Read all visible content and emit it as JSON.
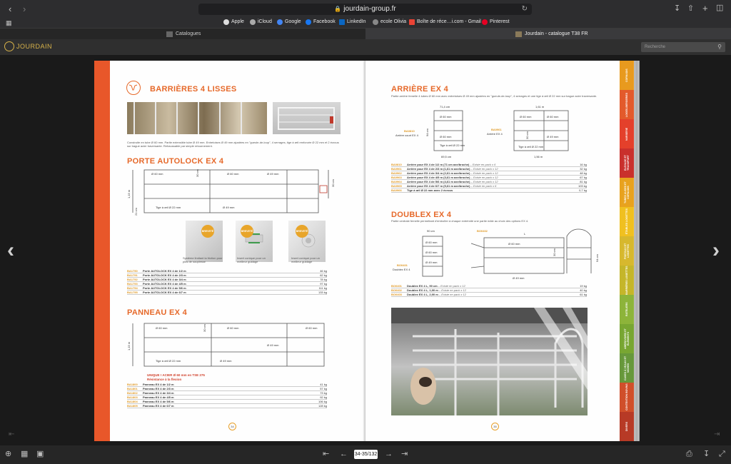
{
  "browser": {
    "url": "jourdain-group.fr",
    "bookmarks": [
      "Apple",
      "iCloud",
      "Google",
      "Facebook",
      "LinkedIn",
      "ecole Olivia",
      "Boîte de réce…i.com - Gmail",
      "Pinterest"
    ],
    "tabs": [
      "Catalogues",
      "Jourdain - catalogue T38 FR"
    ]
  },
  "app": {
    "brand": "JOURDAIN",
    "search_placeholder": "Recherche"
  },
  "left_page": {
    "title": "BARRIÈRES 4 LISSES",
    "intro": "Construite en tube Ø 60 mm. Partie extensible tube Ø 49 mm. Entretoises Ø 49 mm ajustées en \"gueule-de-loup\", 4 serrages, tige à œil renforcée Ø 22 mm et 2 écrous sur bague acier traversante. Rehaussable par simple retournement.",
    "porte": {
      "title": "PORTE AUTOLOCK EX 4",
      "dims": [
        "Ø 60 mm",
        "30 cm",
        "Ø 60 mm",
        "Ø 49 mm",
        "30 cm",
        "1,15 m",
        "21 cm",
        "Tige à œil Ø 22 mm",
        "Ø 49 mm"
      ],
      "badges": [
        "BREVETÉ",
        "BREVETÉ",
        "BREVETÉ"
      ],
      "captions": [
        "Système limitant la friction pour plus de souplesse",
        "Insert conique pour un meilleur guidage",
        "Insert conique pour un meilleur guidage"
      ],
      "rows": [
        {
          "code": "BA1750",
          "desc": "Porte AUTOLOCK EX 4 de 1/2 m",
          "w": "46 kg"
        },
        {
          "code": "BA1751",
          "desc": "Porte AUTOLOCK EX 4 de 2/3 m",
          "w": "62 kg"
        },
        {
          "code": "BA1752",
          "desc": "Porte AUTOLOCK EX 4 de 3/4 m",
          "w": "78 kg"
        },
        {
          "code": "BA1753",
          "desc": "Porte AUTOLOCK EX 4 de 4/5 m",
          "w": "97 kg"
        },
        {
          "code": "BA1754",
          "desc": "Porte AUTOLOCK EX 4 de 5/6 m",
          "w": "111 kg"
        },
        {
          "code": "BA1755",
          "desc": "Porte AUTOLOCK EX 4 de 6/7 m",
          "w": "133 kg"
        }
      ]
    },
    "panneau": {
      "title": "PANNEAU EX 4",
      "dims": [
        "Ø 60 mm",
        "30 cm",
        "Ø 60 mm",
        "Ø 60 mm",
        "1,15 m",
        "Ø 49 mm",
        "Tige à œil Ø 22 mm",
        "Ø 49 mm"
      ],
      "note1": "UNIQUE ! ACIER Ø 60 mm en TSE 275",
      "note2": "Résistance à la flexion",
      "rows": [
        {
          "code": "BA1800",
          "desc": "Panneau EX 4 de 1/2 m",
          "w": "41 kg"
        },
        {
          "code": "BA1801",
          "desc": "Panneau EX 4 de 2/3 m",
          "w": "57 kg"
        },
        {
          "code": "BA1802",
          "desc": "Panneau EX 4 de 3/4 m",
          "w": "73 kg"
        },
        {
          "code": "BA1803",
          "desc": "Panneau EX 4 de 4/5 m",
          "w": "92 kg"
        },
        {
          "code": "BA1804",
          "desc": "Panneau EX 4 de 5/6 m",
          "w": "106 kg"
        },
        {
          "code": "BA1805",
          "desc": "Panneau EX 4 de 6/7 m",
          "w": "128 kg"
        }
      ]
    },
    "page_number": "34"
  },
  "right_page": {
    "arriere": {
      "title": "ARRIÈRE EX 4",
      "intro": "Partie arrière femelle 4 tubes Ø 60 mm avec entretoises Ø 49 mm ajustées en \"gueule-de-loup\", 4 serrages et une tige à œil Ø 22 mm sur bague acier traversante.",
      "dim_labels": [
        "71,4 cm",
        "Ø 60 mm",
        "94 cm",
        "Ø 60 mm",
        "BA0810",
        "Arrière court EX 4",
        "Tige à œil Ø 22 mm",
        "69,5 cm",
        "1,61 m",
        "Ø 60 mm",
        "Ø 60 mm",
        "BA0961",
        "Arrière EX 4",
        "30 cm",
        "Ø 49 mm",
        "Tige à œil Ø 22 mm",
        "1,56 m"
      ],
      "rows": [
        {
          "code": "BA0810",
          "desc": "Arrière pour EX 4 de 1/2 m (71 cm axe/broche)",
          "note": "Existe en pack x 6",
          "w": "16 kg"
        },
        {
          "code": "BA0961",
          "desc": "Arrière pour EX 4 de 2/3 m (1,61 m axe/broche)",
          "note": "Existe en pack x 12",
          "w": "32 kg"
        },
        {
          "code": "BA0962",
          "desc": "Arrière pour EX 4 de 3/4 m (2,61 m axe/broche)",
          "note": "Existe en pack x 12",
          "w": "48 kg"
        },
        {
          "code": "BA0963",
          "desc": "Arrière pour EX 4 de 4/5 m (3,61 m axe/broche)",
          "note": "Existe en pack x 12",
          "w": "67 kg"
        },
        {
          "code": "BA0964",
          "desc": "Arrière pour EX 4 de 5/6 m (4,61 m axe/broche)",
          "note": "Existe en pack x 12",
          "w": "81 kg"
        },
        {
          "code": "BA0965",
          "desc": "Arrière pour EX 4 de 6/7 m (5,61 m axe/broche)",
          "note": "Existe en pack x 6",
          "w": "103 kg"
        },
        {
          "code": "BA0966",
          "desc": "Tige à œil Ø 22 mm avec 2 écrous",
          "note": "",
          "w": "0,7 kg"
        }
      ]
    },
    "doublex": {
      "title": "DOUBLEX EX 4",
      "intro": "Partie centrale femelle permettant d'emboîter à chaque extrémité une partie mâle au choix des options EX 4.",
      "dim_labels": [
        "90 cm",
        "Ø 60 mm",
        "Ø 60 mm",
        "Ø 49 mm",
        "BO0401",
        "Doublex EX 4",
        "BO0402",
        "L",
        "Ø 60 mm",
        "30 cm",
        "Ø 49 mm",
        "94 cm"
      ],
      "rows": [
        {
          "code": "BO0401",
          "desc": "Doublex EX 4 L, 90 cm",
          "note": "Existe en pack x 12",
          "w": "19 kg"
        },
        {
          "code": "BO0402",
          "desc": "Doublex EX 4 L, 1,90 m",
          "note": "Existe en pack x 12",
          "w": "40 kg"
        },
        {
          "code": "BO0403",
          "desc": "Doublex EX 4 L, 2,90 m",
          "note": "Existe en pack x 12",
          "w": "61 kg"
        }
      ]
    },
    "page_number": "35"
  },
  "side_tabs": [
    {
      "label": "CORNADIS",
      "color": "#e89a1e"
    },
    {
      "label": "LOGES-BERGERIES",
      "color": "#e35a2b"
    },
    {
      "label": "NURSERIE",
      "color": "#e4402b"
    },
    {
      "label": "ELEVAGE ET TRANSPORT",
      "color": "#c9302c"
    },
    {
      "label": "TUBES AUGES ET CORNADIS",
      "color": "#e8a21e"
    },
    {
      "label": "ÉTABLES LOGETTES",
      "color": "#f0c020"
    },
    {
      "label": "POSTAUX ET LOGETTES",
      "color": "#d7b82e"
    },
    {
      "label": "BARRIÈRES LOGETTES",
      "color": "#c5b62a"
    },
    {
      "label": "RATELIERS",
      "color": "#8db43a"
    },
    {
      "label": "ABREUVOIRS ET ÉLÉMENTS",
      "color": "#78a632"
    },
    {
      "label": "CASES À VEAUX ET NICHES",
      "color": "#67983b"
    },
    {
      "label": "CONTENTION BOVINS",
      "color": "#d04f2a"
    },
    {
      "label": "DIVERS",
      "color": "#b73a26"
    }
  ],
  "footer": {
    "page_indicator": "34-35/132"
  },
  "colors": {
    "accent_orange": "#e6692a",
    "code_orange": "#e09a27",
    "brand_gold": "#d8b34a"
  }
}
